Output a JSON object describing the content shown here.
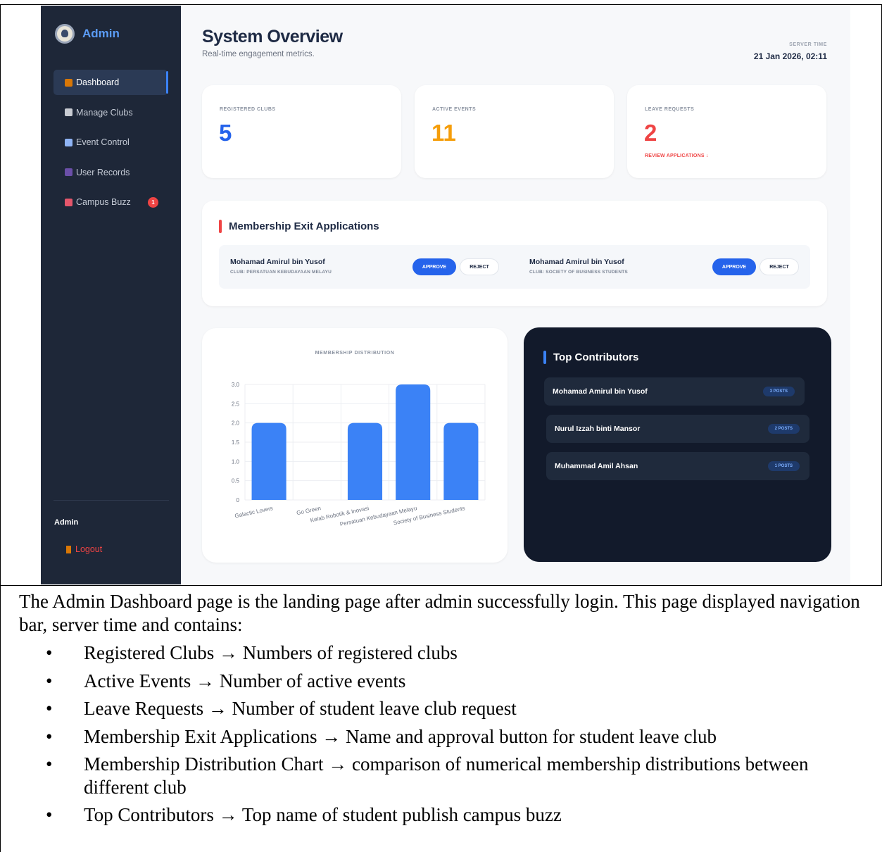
{
  "sidebar": {
    "brand": "Admin",
    "nav": [
      {
        "label": "Dashboard",
        "icon": "house-icon",
        "active": true
      },
      {
        "label": "Manage Clubs",
        "icon": "building-icon"
      },
      {
        "label": "Event Control",
        "icon": "calendar-icon"
      },
      {
        "label": "User Records",
        "icon": "users-icon"
      },
      {
        "label": "Campus Buzz",
        "icon": "megaphone-icon",
        "badge": "1"
      }
    ],
    "user": "Admin",
    "logout": "Logout"
  },
  "header": {
    "title": "System Overview",
    "subtitle": "Real-time engagement metrics.",
    "server_time_label": "SERVER TIME",
    "server_time": "21 Jan 2026, 02:11"
  },
  "stats": [
    {
      "label": "REGISTERED CLUBS",
      "value": "5",
      "color": "#2563eb"
    },
    {
      "label": "ACTIVE EVENTS",
      "value": "11",
      "color": "#f59e0b"
    },
    {
      "label": "LEAVE REQUESTS",
      "value": "2",
      "color": "#ef4444",
      "link": "REVIEW APPLICATIONS ↓"
    }
  ],
  "exit_applications": {
    "title": "Membership Exit Applications",
    "items": [
      {
        "name": "Mohamad Amirul bin Yusof",
        "club": "CLUB: PERSATUAN KEBUDAYAAN MELAYU",
        "approve": "APPROVE",
        "reject": "REJECT"
      },
      {
        "name": "Mohamad Amirul bin Yusof",
        "club": "CLUB: SOCIETY OF BUSINESS STUDENTS",
        "approve": "APPROVE",
        "reject": "REJECT"
      }
    ]
  },
  "chart_data": {
    "type": "bar",
    "title": "MEMBERSHIP DISTRIBUTION",
    "categories": [
      "Galactic Lovers",
      "Go Green",
      "Kelab Robotik & Inovasi",
      "Persatuan Kebudayaan Melayu",
      "Society of Business Students"
    ],
    "values": [
      2,
      0,
      2,
      3,
      2
    ],
    "ylim": [
      0,
      3
    ],
    "yticks": [
      "0",
      "0.5",
      "1.0",
      "1.5",
      "2.0",
      "2.5",
      "3.0"
    ],
    "bar_color": "#3b82f6",
    "grid": true
  },
  "contributors": {
    "title": "Top Contributors",
    "items": [
      {
        "name": "Mohamad Amirul bin Yusof",
        "posts": "3 POSTS"
      },
      {
        "name": "Nurul Izzah binti Mansor",
        "posts": "2 POSTS"
      },
      {
        "name": "Muhammad Amil Ahsan",
        "posts": "1 POSTS"
      }
    ]
  },
  "document": {
    "intro": "The Admin Dashboard page is the landing page after admin successfully login. This page displayed navigation bar, server time and contains:",
    "bullets": [
      "Registered Clubs → Numbers of registered clubs",
      "Active Events → Number of active events",
      "Leave Requests → Number of student leave club request",
      "Membership Exit Applications → Name and approval button for student leave club",
      "Membership Distribution Chart → comparison of numerical membership distributions between different club",
      "Top Contributors → Top name of student publish campus buzz"
    ]
  }
}
